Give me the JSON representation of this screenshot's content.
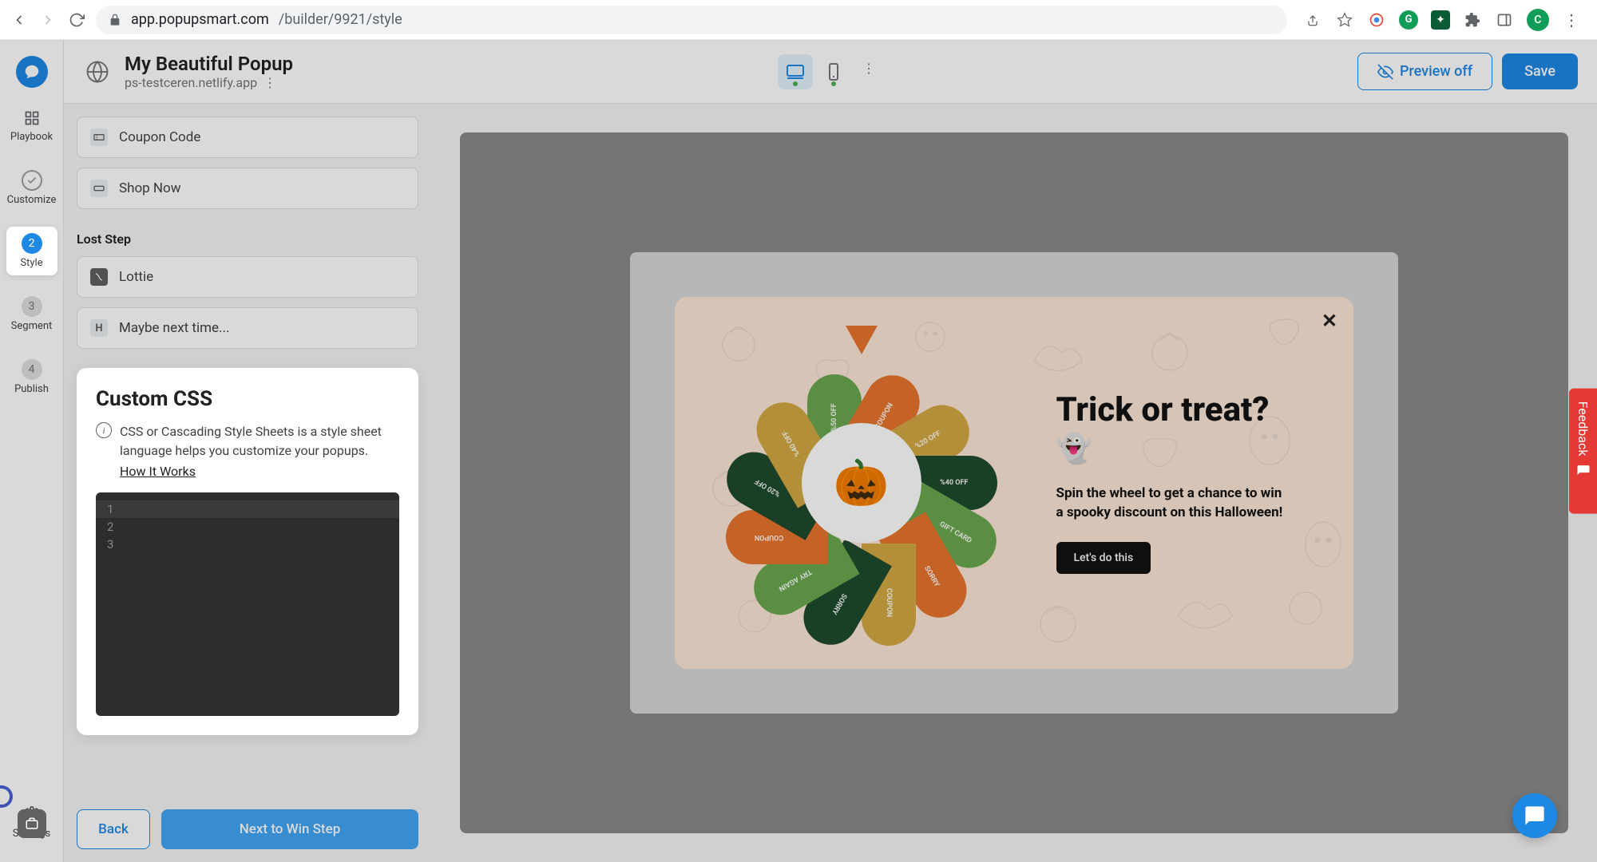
{
  "browser": {
    "url_host": "app.popupsmart.com",
    "url_path": "/builder/9921/style",
    "avatar_letter": "C"
  },
  "rail": {
    "items": [
      {
        "label": "Playbook"
      },
      {
        "label": "Customize"
      },
      {
        "step": "2",
        "label": "Style"
      },
      {
        "step": "3",
        "label": "Segment"
      },
      {
        "step": "4",
        "label": "Publish"
      }
    ],
    "settings_label": "Settings"
  },
  "topbar": {
    "title": "My Beautiful Popup",
    "subtitle": "ps-testceren.netlify.app",
    "preview_label": "Preview off",
    "save_label": "Save"
  },
  "sidebar": {
    "items": [
      {
        "label": "Coupon Code"
      },
      {
        "label": "Shop Now"
      }
    ],
    "lost_step_label": "Lost Step",
    "lost_items": [
      {
        "label": "Lottie"
      },
      {
        "label": "Maybe next time..."
      }
    ],
    "custom_css": {
      "title": "Custom CSS",
      "info": "CSS or Cascading Style Sheets is a style sheet language helps you customize your popups.",
      "link": "How It Works",
      "lines": [
        "1",
        "2",
        "3"
      ]
    },
    "back_label": "Back",
    "next_label": "Next to Win Step"
  },
  "popup": {
    "title": "Trick or treat?",
    "emoji": "👻",
    "desc": "Spin the wheel to get a chance to win a spooky discount on this Halloween!",
    "cta": "Let's do this",
    "center_emoji": "🎃",
    "slices": [
      {
        "label": "%50 OFF",
        "color": "#6aa84f"
      },
      {
        "label": "COUPON",
        "color": "#e8742c"
      },
      {
        "label": "%20 OFF",
        "color": "#d4a843"
      },
      {
        "label": "%40 OFF",
        "color": "#1f4a2e"
      },
      {
        "label": "GIFT CARD",
        "color": "#6aa84f"
      },
      {
        "label": "SORRY",
        "color": "#e8742c"
      },
      {
        "label": "COUPON",
        "color": "#d4a843"
      },
      {
        "label": "SORRY",
        "color": "#1f4a2e"
      },
      {
        "label": "TRY AGAIN",
        "color": "#6aa84f"
      },
      {
        "label": "COUPON",
        "color": "#e8742c"
      },
      {
        "label": "%20 OFF",
        "color": "#1f4a2e"
      },
      {
        "label": "%40 OFF",
        "color": "#d4a843"
      }
    ]
  },
  "feedback_label": "Feedback"
}
